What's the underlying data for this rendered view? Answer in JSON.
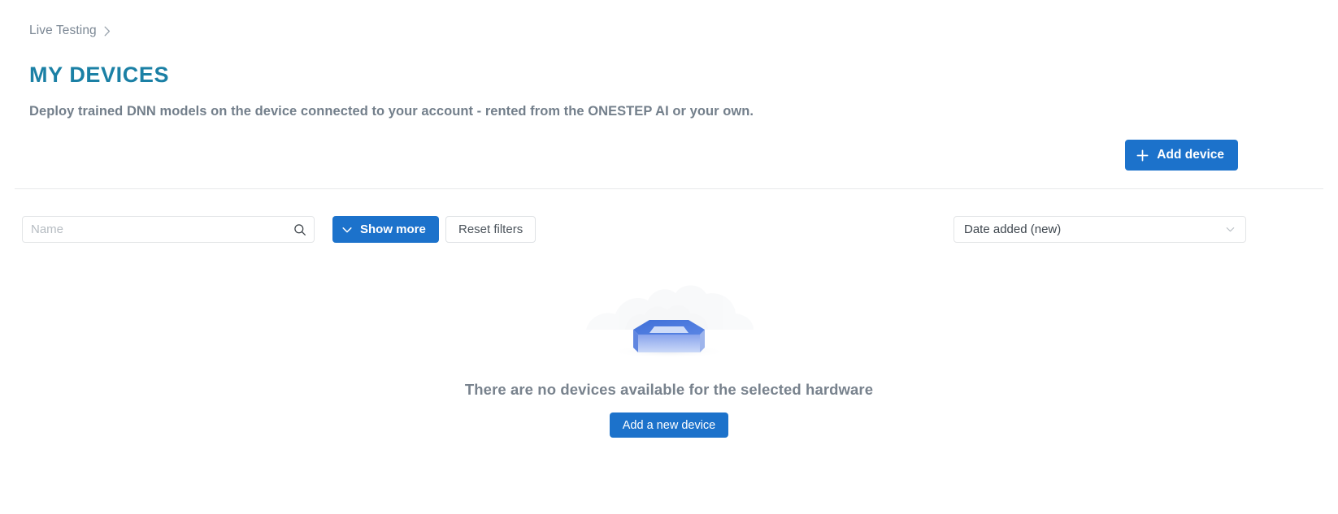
{
  "breadcrumb": {
    "items": [
      {
        "label": "Live Testing"
      }
    ],
    "separator_icon": "chevron-right-icon"
  },
  "header": {
    "title": "MY DEVICES",
    "subtitle": "Deploy trained DNN models on the device connected to your account - rented from the ONESTEP AI or your own.",
    "add_device_label": "Add device",
    "add_device_icon": "plus-icon"
  },
  "filters": {
    "search": {
      "placeholder": "Name",
      "value": "",
      "icon": "search-icon"
    },
    "show_more_label": "Show more",
    "show_more_icon": "chevron-down-icon",
    "reset_filters_label": "Reset filters",
    "sort": {
      "selected": "Date added (new)",
      "icon": "chevron-down-icon",
      "options": [
        "Date added (new)"
      ]
    }
  },
  "empty_state": {
    "illustration": "empty-box-illustration",
    "message": "There are no devices available for the selected hardware",
    "action_label": "Add a new device"
  },
  "colors": {
    "brand_teal": "#1b80a5",
    "primary_blue": "#1c72cb",
    "text_gray": "#78828d",
    "border_gray": "#e3e5e7",
    "divider": "#e7e9eb",
    "illustration_blue": "#3f6fd8",
    "illustration_light": "#c5d4f5"
  }
}
